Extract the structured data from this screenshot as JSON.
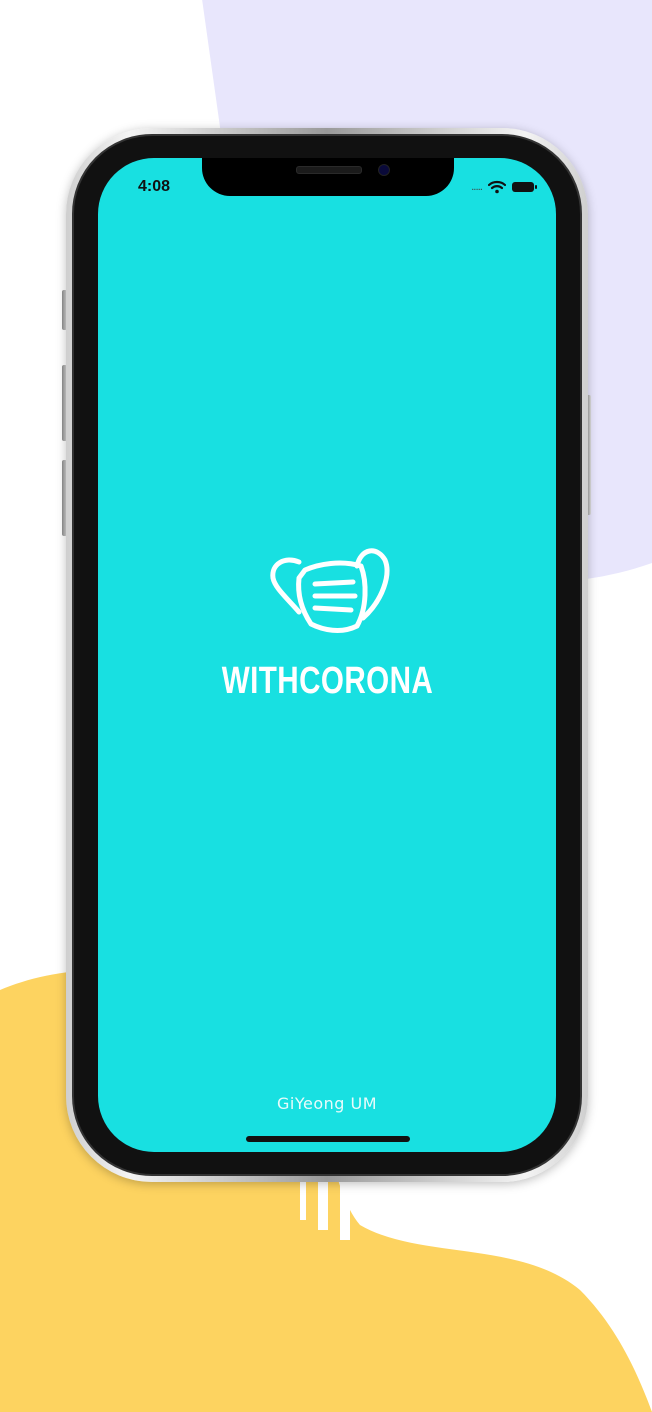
{
  "status_bar": {
    "time": "4:08",
    "signal": "....."
  },
  "splash": {
    "app_name": "WITHCORONA",
    "author": "GiYeong UM",
    "icon": "face-mask-icon"
  },
  "colors": {
    "screen_background": "#18e0e1",
    "blob_purple": "#e8e6fc",
    "blob_yellow": "#fdd360",
    "logo_foreground": "#ffffff"
  }
}
